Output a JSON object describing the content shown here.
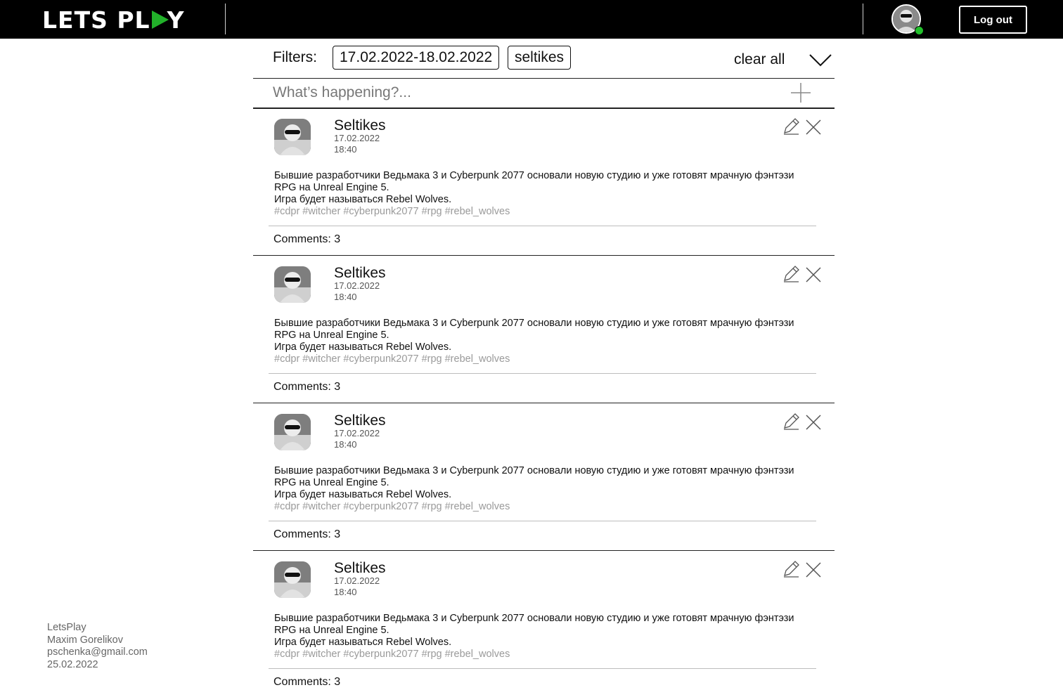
{
  "header": {
    "logo_left": "LETS PL",
    "logo_right": "Y",
    "logout_label": "Log out"
  },
  "filters": {
    "label": "Filters:",
    "chips": [
      "17.02.2022-18.02.2022",
      "seltikes"
    ],
    "clear_label": "clear all"
  },
  "compose": {
    "placeholder": "What’s happening?..."
  },
  "posts": [
    {
      "author": "Seltikes",
      "date": "17.02.2022",
      "time": "18:40",
      "text_line1": "Бывшие разработчики Ведьмака 3 и  Cyberpunk 2077 основали новую студию и уже готовят мрачную фэнтэзи RPG на Unreal Engine 5.",
      "text_line2": "Игра будет называться Rebel Wolves.",
      "tags": "#cdpr #witcher #cyberpunk2077 #rpg #rebel_wolves",
      "comments": "Comments: 3"
    },
    {
      "author": "Seltikes",
      "date": "17.02.2022",
      "time": "18:40",
      "text_line1": "Бывшие разработчики Ведьмака 3 и  Cyberpunk 2077 основали новую студию и уже готовят мрачную фэнтэзи RPG на Unreal Engine 5.",
      "text_line2": "Игра будет называться Rebel Wolves.",
      "tags": "#cdpr #witcher #cyberpunk2077 #rpg #rebel_wolves",
      "comments": "Comments: 3"
    },
    {
      "author": "Seltikes",
      "date": "17.02.2022",
      "time": "18:40",
      "text_line1": "Бывшие разработчики Ведьмака 3 и  Cyberpunk 2077 основали новую студию и уже готовят мрачную фэнтэзи RPG на Unreal Engine 5.",
      "text_line2": "Игра будет называться Rebel Wolves.",
      "tags": "#cdpr #witcher #cyberpunk2077 #rpg #rebel_wolves",
      "comments": "Comments: 3"
    },
    {
      "author": "Seltikes",
      "date": "17.02.2022",
      "time": "18:40",
      "text_line1": "Бывшие разработчики Ведьмака 3 и  Cyberpunk 2077 основали новую студию и уже готовят мрачную фэнтэзи RPG на Unreal Engine 5.",
      "text_line2": "Игра будет называться Rebel Wolves.",
      "tags": "#cdpr #witcher #cyberpunk2077 #rpg #rebel_wolves",
      "comments": "Comments: 3"
    }
  ],
  "footer": {
    "app": "LetsPlay",
    "author": "Maxim Gorelikov",
    "email": "pschenka@gmail.com",
    "date": "25.02.2022"
  },
  "colors": {
    "header_bg": "#000000",
    "accent_green": "#22b12a",
    "online_green": "#22c02b",
    "tag_gray": "#9a9a9a"
  },
  "icons": [
    "play-triangle-icon",
    "chevron-down-icon",
    "plus-icon",
    "pencil-icon",
    "close-icon"
  ]
}
